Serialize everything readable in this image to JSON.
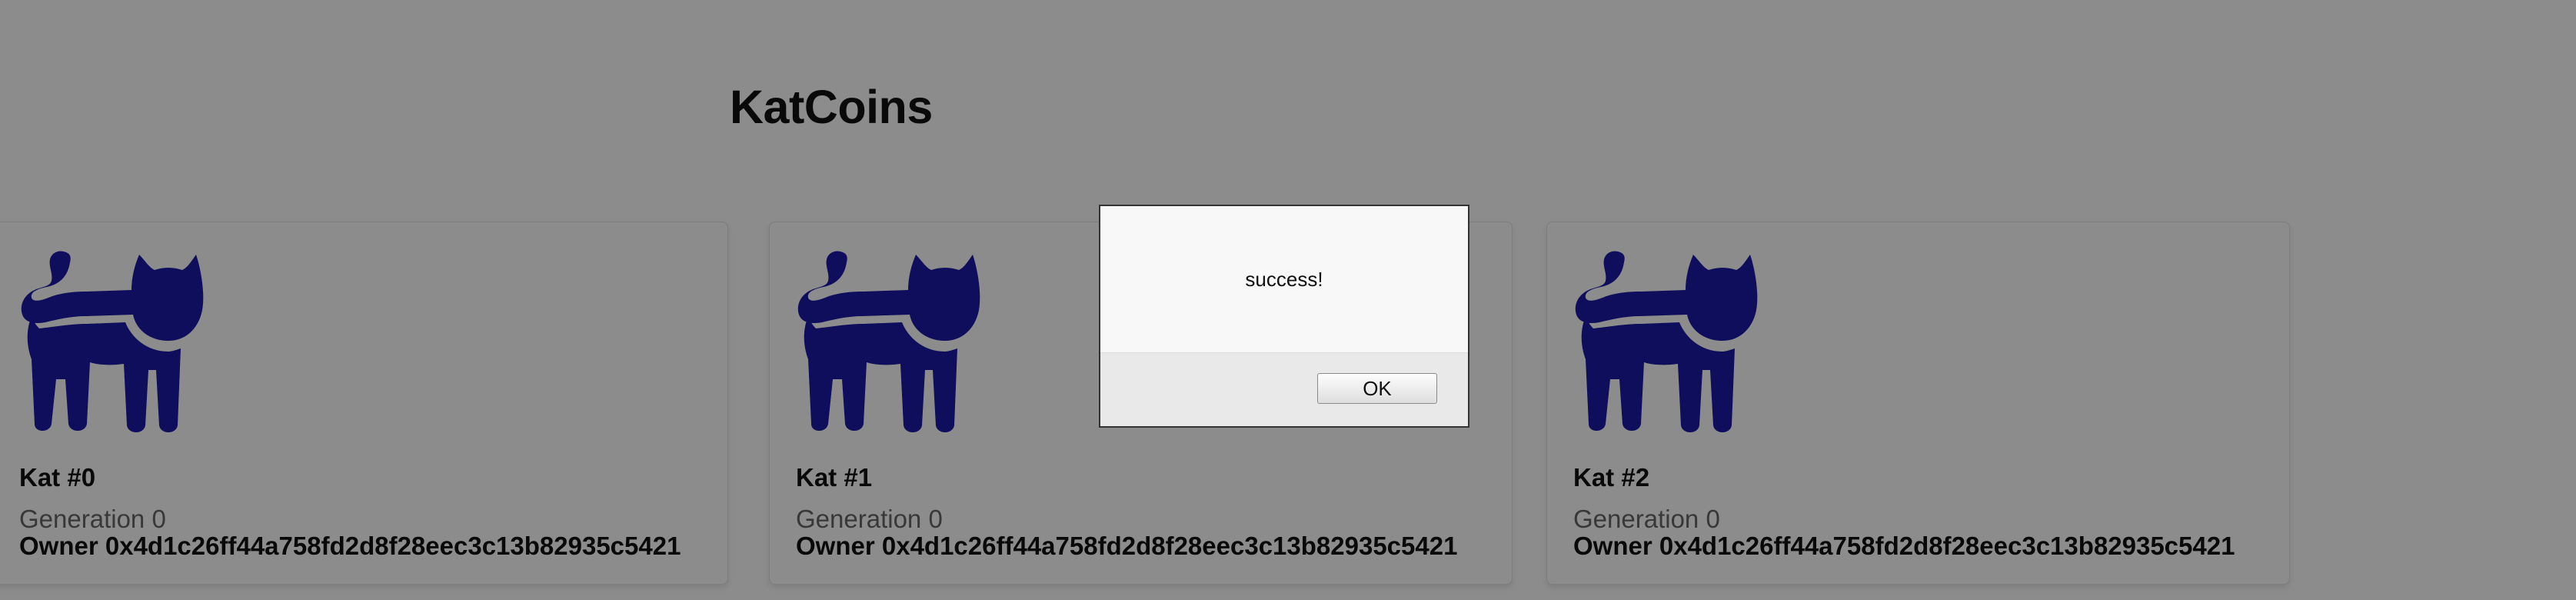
{
  "page": {
    "title": "KatCoins"
  },
  "cards": [
    {
      "name": "Kat #0",
      "generation": "Generation 0",
      "owner": "Owner 0x4d1c26ff44a758fd2d8f28eec3c13b82935c5421",
      "icon": "cat-icon",
      "color": "#1a1aa8"
    },
    {
      "name": "Kat #1",
      "generation": "Generation 0",
      "owner": "Owner 0x4d1c26ff44a758fd2d8f28eec3c13b82935c5421",
      "icon": "cat-icon",
      "color": "#1a1aa8"
    },
    {
      "name": "Kat #2",
      "generation": "Generation 0",
      "owner": "Owner 0x4d1c26ff44a758fd2d8f28eec3c13b82935c5421",
      "icon": "cat-icon",
      "color": "#1a1aa8"
    }
  ],
  "dialog": {
    "message": "success!",
    "ok_label": "OK"
  },
  "colors": {
    "overlay": "rgba(0,0,0,0.45)",
    "cat": "#1a1aa8"
  }
}
